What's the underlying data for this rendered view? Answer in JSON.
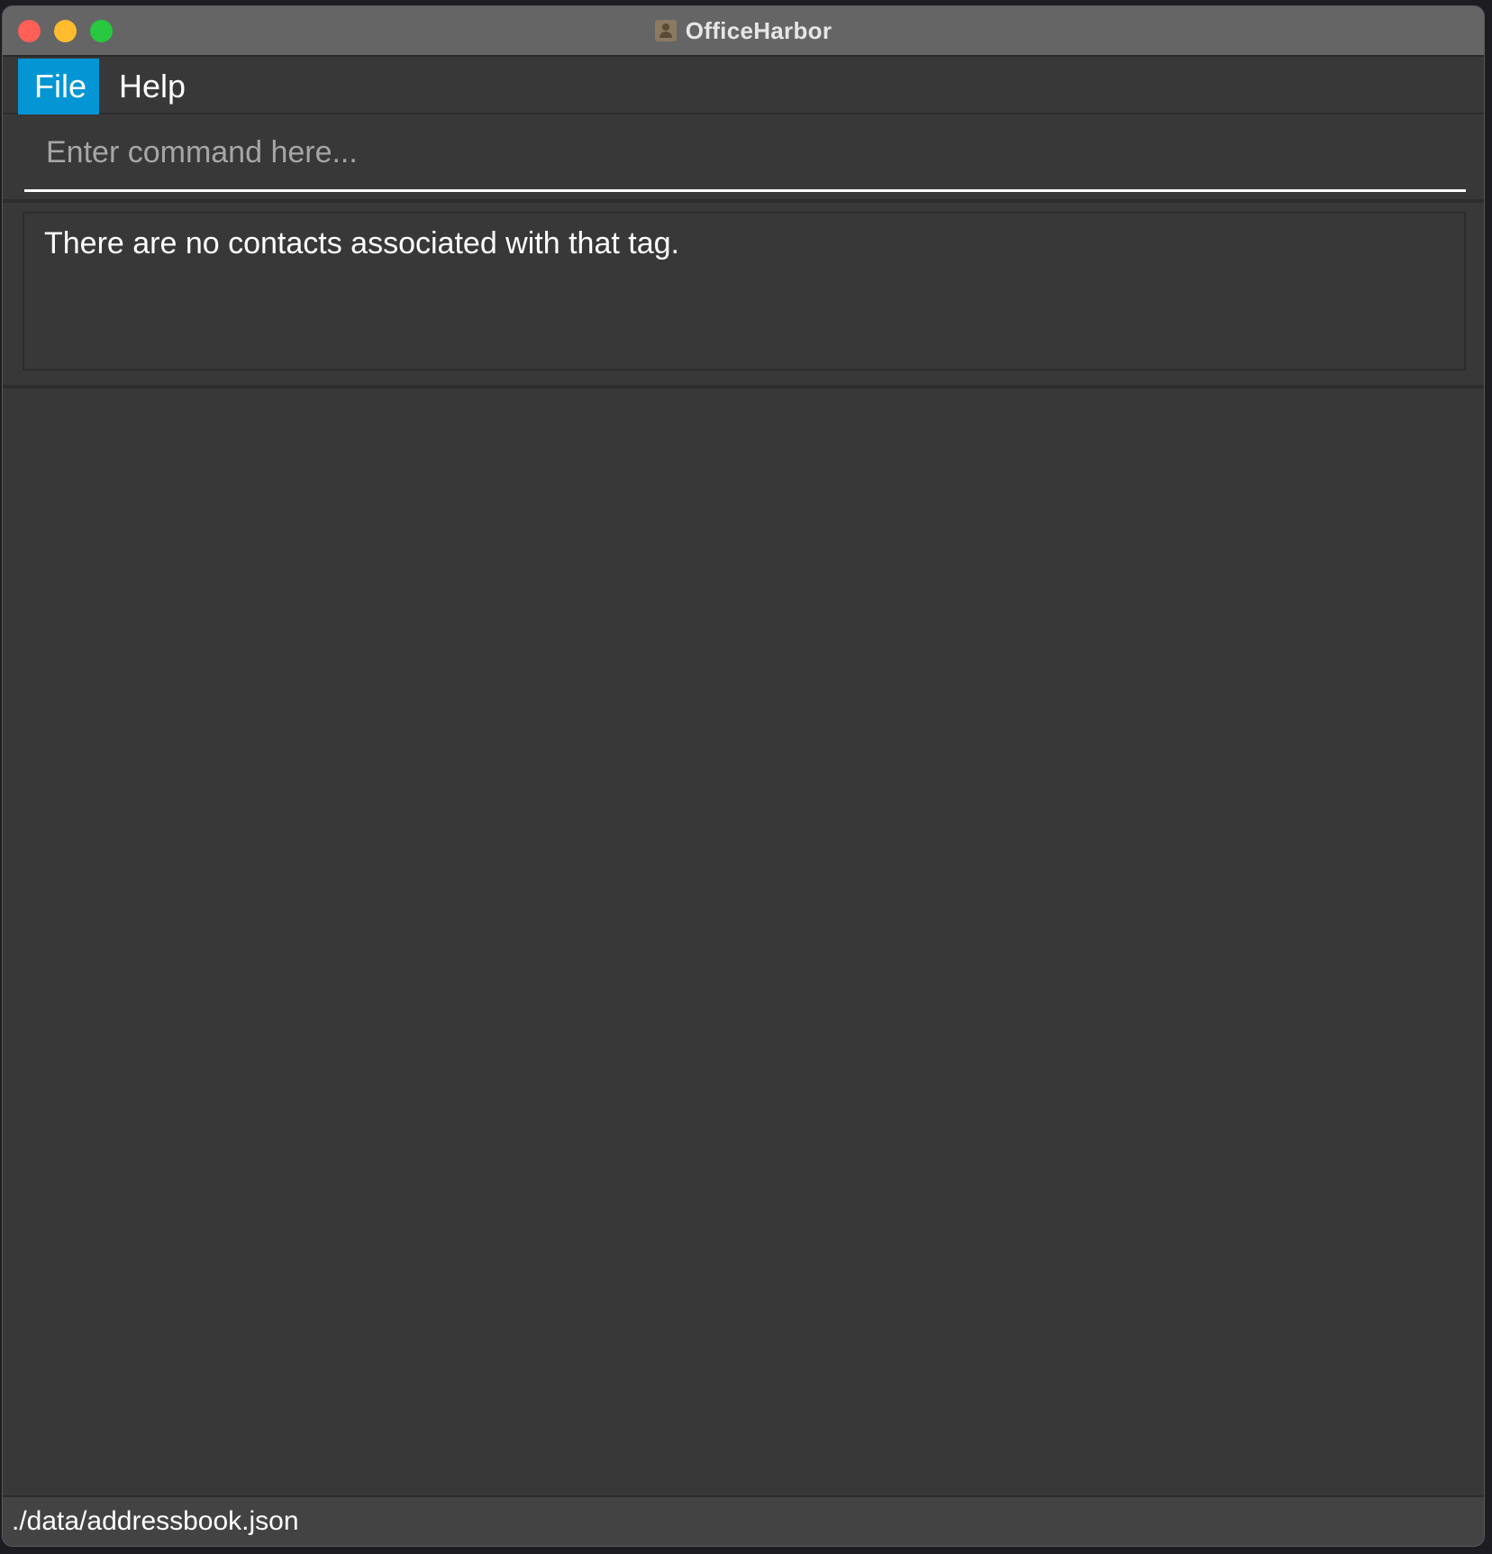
{
  "window": {
    "title": "OfficeHarbor",
    "app_icon": "contact-book-icon"
  },
  "menu": {
    "items": [
      {
        "label": "File",
        "active": true
      },
      {
        "label": "Help",
        "active": false
      }
    ]
  },
  "command": {
    "placeholder": "Enter command here...",
    "value": ""
  },
  "result": {
    "message": "There are no contacts associated with that tag."
  },
  "status_bar": {
    "file_path": "./data/addressbook.json"
  },
  "colors": {
    "accent": "#0496d4",
    "background": "#383838",
    "titlebar": "#656565"
  }
}
